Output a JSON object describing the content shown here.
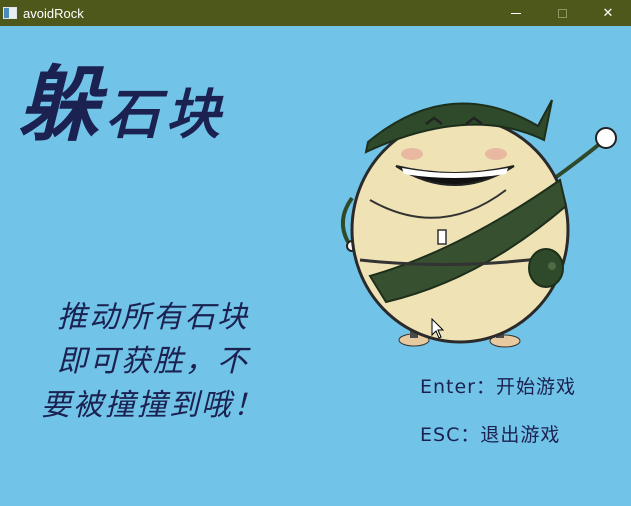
{
  "window": {
    "title": "avoidRock",
    "controls": {
      "minimize": "minimize-icon",
      "maximize": "maximize-icon",
      "close": "✕"
    }
  },
  "game": {
    "title_big": "躲",
    "title_rest": "石块",
    "instructions": [
      "推动所有石块",
      "即可获胜，不",
      "要被撞撞到哦！"
    ],
    "menu": {
      "enter": "Enter：开始游戏",
      "esc": "ESC：退出游戏"
    },
    "mascot_icon": "egg-mascot-icon"
  },
  "colors": {
    "titlebar": "#4e581a",
    "background": "#71c4e8",
    "text": "#1b2150"
  }
}
